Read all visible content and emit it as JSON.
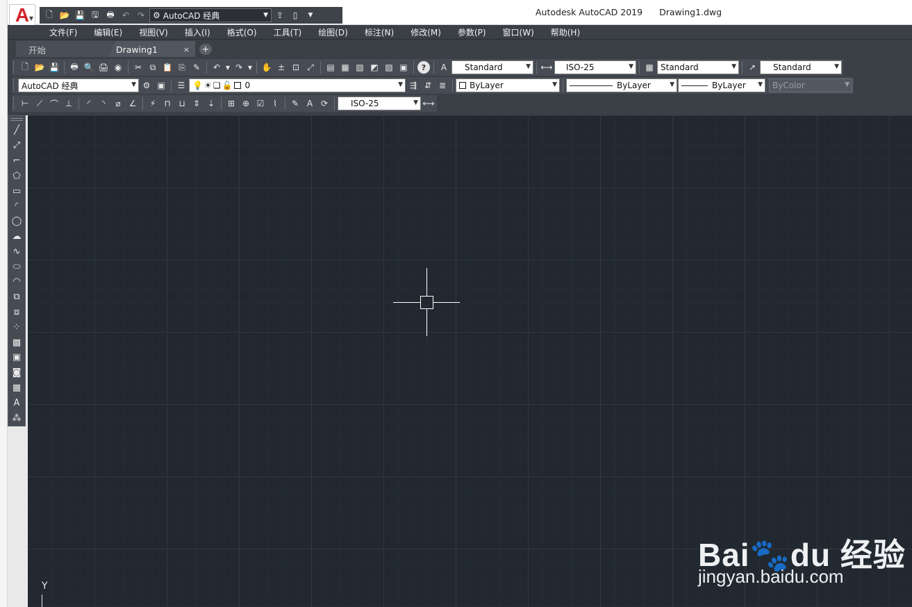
{
  "app": {
    "logo_letter": "A",
    "product_title": "Autodesk AutoCAD 2019",
    "document_title": "Drawing1.dwg"
  },
  "quick_access": {
    "workspace_label": "AutoCAD 经典"
  },
  "menu": [
    "文件(F)",
    "编辑(E)",
    "视图(V)",
    "插入(I)",
    "格式(O)",
    "工具(T)",
    "绘图(D)",
    "标注(N)",
    "修改(M)",
    "参数(P)",
    "窗口(W)",
    "帮助(H)"
  ],
  "tabs": {
    "start_label": "开始",
    "drawing_label": "Drawing1",
    "close_glyph": "×",
    "add_glyph": "+"
  },
  "styles_toolbar": {
    "text_style": "Standard",
    "dim_style": "ISO-25",
    "table_style": "Standard",
    "multileader_style": "Standard"
  },
  "workspace_toolbar": {
    "workspace": "AutoCAD 经典"
  },
  "layers_toolbar": {
    "current_layer": "0"
  },
  "properties_toolbar": {
    "color": "ByLayer",
    "linetype": "ByLayer",
    "lineweight": "ByLayer",
    "plot_style": "ByColor"
  },
  "dimension_toolbar": {
    "dim_style": "ISO-25"
  },
  "canvas": {
    "background_color": "#212830",
    "ucs_label": "Y"
  },
  "watermark": {
    "brand": "Bai🐾du 经验",
    "url": "jingyan.baidu.com"
  }
}
